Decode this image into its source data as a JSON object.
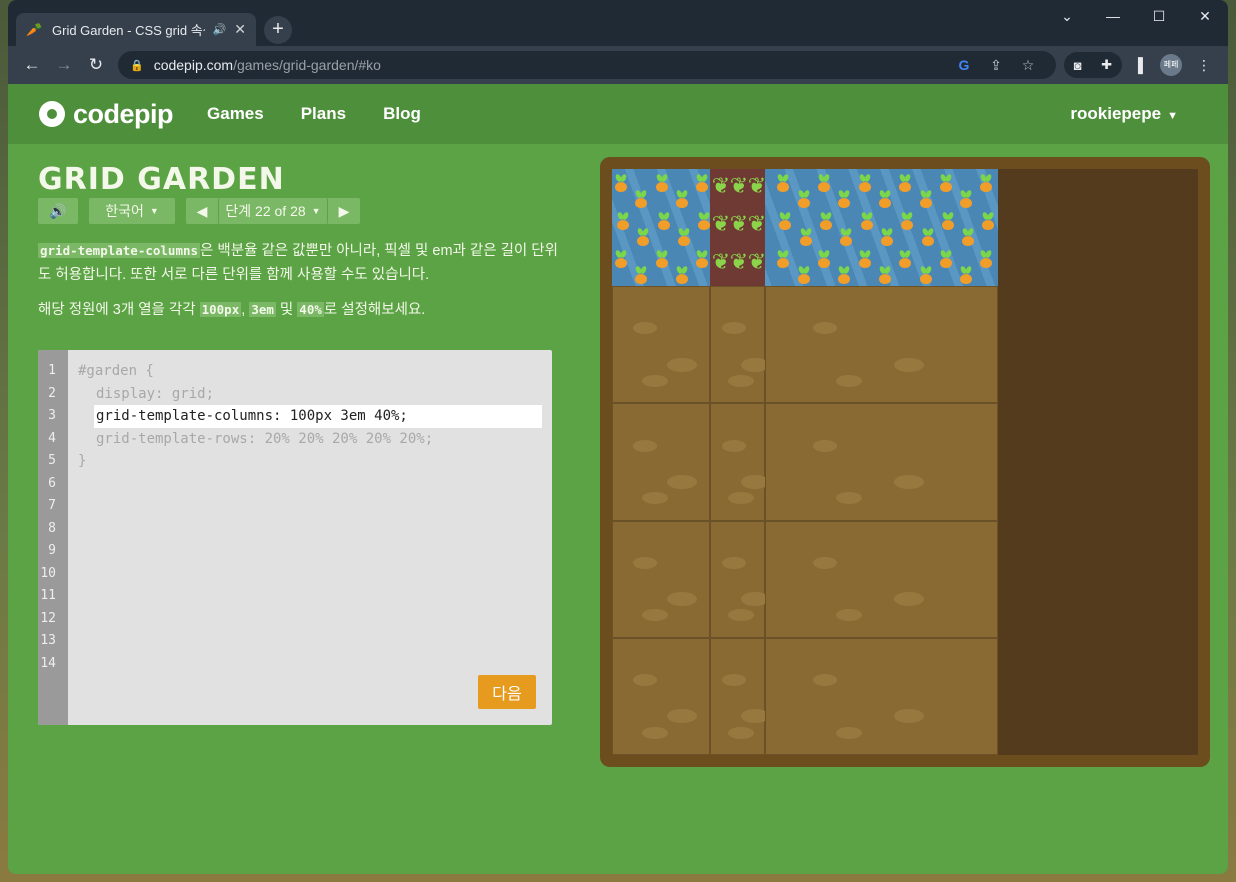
{
  "browser": {
    "tab_title": "Grid Garden - CSS grid 속성",
    "tab_favicon": "carrot-icon",
    "url_host": "codepip.com",
    "url_path": "/games/grid-garden/#ko",
    "profile_initials": "페페"
  },
  "site": {
    "logo": "codepip",
    "nav": [
      "Games",
      "Plans",
      "Blog"
    ],
    "user": "rookiepepe"
  },
  "game": {
    "title": "GRID GARDEN",
    "language": "한국어",
    "level_label": "단계 22 of 28",
    "description_code": "grid-template-columns",
    "description_text": "은 백분율 같은 값뿐만 아니라, 픽셀 및 em과 같은 길이 단위도 허용합니다. 또한 서로 다른 단위를 함께 사용할 수도 있습니다.",
    "instruction_prefix": "해당 정원에 3개 열을 각각 ",
    "instruction_v1": "100px",
    "instruction_sep1": ", ",
    "instruction_v2": "3em",
    "instruction_sep2": " 및 ",
    "instruction_v3": "40%",
    "instruction_suffix": "로 설정해보세요.",
    "next_button": "다음"
  },
  "editor": {
    "line_numbers": [
      "1",
      "2",
      "3",
      "4",
      "5",
      "6",
      "7",
      "8",
      "9",
      "10",
      "11",
      "12",
      "13",
      "14"
    ],
    "line1": "#garden {",
    "line2": "display: grid;",
    "input_value": "grid-template-columns: 100px 3em 40%;",
    "line4": "grid-template-rows: 20% 20% 20% 20% 20%;",
    "line5": "}"
  },
  "colors": {
    "page_green": "#5ba344",
    "header_green": "#4e8f3b",
    "button_orange": "#e69a1e",
    "soil": "#8a6a33",
    "water": "#4a87b5",
    "poison": "#6e3a33"
  }
}
